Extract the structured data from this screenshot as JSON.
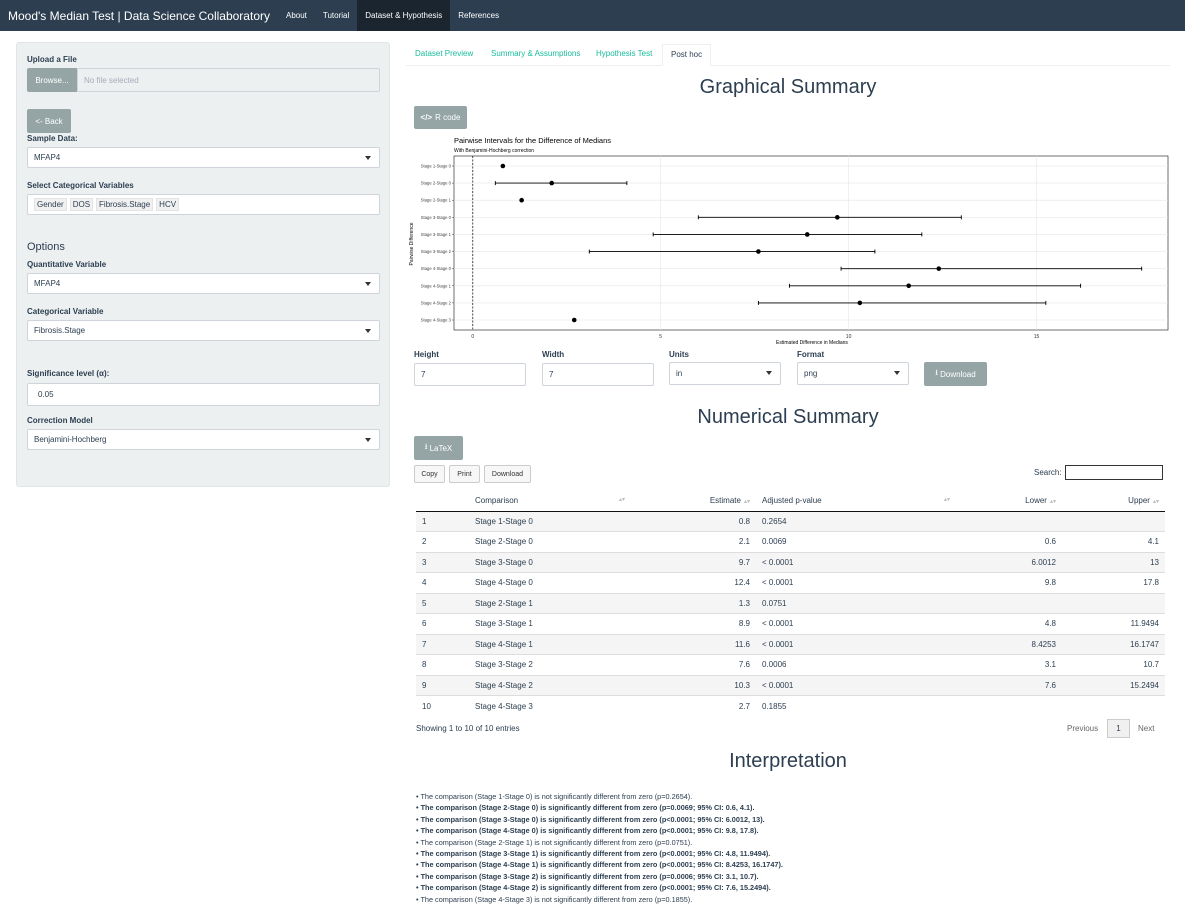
{
  "navbar": {
    "brand": "Mood's Median Test | Data Science Collaboratory",
    "items": [
      "About",
      "Tutorial",
      "Dataset & Hypothesis",
      "References"
    ],
    "active_index": 2
  },
  "sidebar": {
    "upload_label": "Upload a File",
    "browse_label": "Browse...",
    "file_placeholder": "No file selected",
    "back_label": "<- Back",
    "sample_label": "Sample Data:",
    "sample_value": "MFAP4",
    "catvars_label": "Select Categorical Variables",
    "catvars": [
      "Gender",
      "DOS",
      "Fibrosis.Stage",
      "HCV"
    ],
    "options_heading": "Options",
    "quant_label": "Quantitative Variable",
    "quant_value": "MFAP4",
    "cat_label": "Categorical Variable",
    "cat_value": "Fibrosis.Stage",
    "alpha_label": "Significance level (α):",
    "alpha_value": "0.05",
    "correction_label": "Correction Model",
    "correction_value": "Benjamini-Hochberg"
  },
  "tabs": [
    "Dataset Preview",
    "Summary & Assumptions",
    "Hypothesis Test",
    "Post hoc"
  ],
  "active_tab": 3,
  "graphical": {
    "heading": "Graphical Summary",
    "rcode_label": "R code",
    "height_label": "Height",
    "height_value": "7",
    "width_label": "Width",
    "width_value": "7",
    "units_label": "Units",
    "units_value": "in",
    "format_label": "Format",
    "format_value": "png",
    "download_label": "Download"
  },
  "chart_data": {
    "type": "scatter",
    "title": "Pairwise Intervals for the Difference of Medians",
    "subtitle": "With Benjamini-Hochberg correction",
    "xlabel": "Estimated Difference in Medians",
    "ylabel": "Pairwise Difference",
    "xlim": [
      -0.5,
      18.5
    ],
    "xticks": [
      0,
      5,
      10,
      15
    ],
    "categories": [
      "Stage 1-Stage 0",
      "Stage 2-Stage 0",
      "Stage 2-Stage 1",
      "Stage 3-Stage 0",
      "Stage 3-Stage 1",
      "Stage 3-Stage 2",
      "Stage 4-Stage 0",
      "Stage 4-Stage 1",
      "Stage 4-Stage 2",
      "Stage 4-Stage 3"
    ],
    "estimates": [
      0.8,
      2.1,
      1.3,
      9.7,
      8.9,
      7.6,
      12.4,
      11.6,
      10.3,
      2.7
    ],
    "lower": [
      null,
      0.6,
      null,
      6.0012,
      4.8,
      3.1,
      9.8,
      8.4253,
      7.6,
      null
    ],
    "upper": [
      null,
      4.1,
      null,
      13,
      11.9494,
      10.7,
      17.8,
      16.1747,
      15.2494,
      null
    ],
    "reference_line": 0,
    "grid": true
  },
  "numerical": {
    "heading": "Numerical Summary",
    "latex_label": "LaTeX",
    "copy_label": "Copy",
    "print_label": "Print",
    "download_label": "Download",
    "search_label": "Search:",
    "columns": [
      "",
      "Comparison",
      "Estimate",
      "Adjusted p-value",
      "Lower",
      "Upper"
    ],
    "rows": [
      [
        "1",
        "Stage 1-Stage 0",
        "0.8",
        "0.2654",
        "",
        ""
      ],
      [
        "2",
        "Stage 2-Stage 0",
        "2.1",
        "0.0069",
        "0.6",
        "4.1"
      ],
      [
        "3",
        "Stage 3-Stage 0",
        "9.7",
        "< 0.0001",
        "6.0012",
        "13"
      ],
      [
        "4",
        "Stage 4-Stage 0",
        "12.4",
        "< 0.0001",
        "9.8",
        "17.8"
      ],
      [
        "5",
        "Stage 2-Stage 1",
        "1.3",
        "0.0751",
        "",
        ""
      ],
      [
        "6",
        "Stage 3-Stage 1",
        "8.9",
        "< 0.0001",
        "4.8",
        "11.9494"
      ],
      [
        "7",
        "Stage 4-Stage 1",
        "11.6",
        "< 0.0001",
        "8.4253",
        "16.1747"
      ],
      [
        "8",
        "Stage 3-Stage 2",
        "7.6",
        "0.0006",
        "3.1",
        "10.7"
      ],
      [
        "9",
        "Stage 4-Stage 2",
        "10.3",
        "< 0.0001",
        "7.6",
        "15.2494"
      ],
      [
        "10",
        "Stage 4-Stage 3",
        "2.7",
        "0.1855",
        "",
        ""
      ]
    ],
    "info": "Showing 1 to 10 of 10 entries",
    "prev_label": "Previous",
    "page": "1",
    "next_label": "Next"
  },
  "interpretation": {
    "heading": "Interpretation",
    "lines": [
      {
        "text": "• The comparison (Stage 1-Stage 0) is not significantly different from zero (p=0.2654).",
        "bold": false
      },
      {
        "text": "• The comparison (Stage 2-Stage 0) is significantly different from zero (p=0.0069; 95% CI: 0.6, 4.1).",
        "bold": true
      },
      {
        "text": "• The comparison (Stage 3-Stage 0) is significantly different from zero (p<0.0001; 95% CI: 6.0012, 13).",
        "bold": true
      },
      {
        "text": "• The comparison (Stage 4-Stage 0) is significantly different from zero (p<0.0001; 95% CI: 9.8, 17.8).",
        "bold": true
      },
      {
        "text": "• The comparison (Stage 2-Stage 1) is not significantly different from zero (p=0.0751).",
        "bold": false
      },
      {
        "text": "• The comparison (Stage 3-Stage 1) is significantly different from zero (p<0.0001; 95% CI: 4.8, 11.9494).",
        "bold": true
      },
      {
        "text": "• The comparison (Stage 4-Stage 1) is significantly different from zero (p<0.0001; 95% CI: 8.4253, 16.1747).",
        "bold": true
      },
      {
        "text": "• The comparison (Stage 3-Stage 2) is significantly different from zero (p=0.0006; 95% CI: 3.1, 10.7).",
        "bold": true
      },
      {
        "text": "• The comparison (Stage 4-Stage 2) is significantly different from zero (p<0.0001; 95% CI: 7.6, 15.2494).",
        "bold": true
      },
      {
        "text": "• The comparison (Stage 4-Stage 3) is not significantly different from zero (p=0.1855).",
        "bold": false
      }
    ]
  }
}
